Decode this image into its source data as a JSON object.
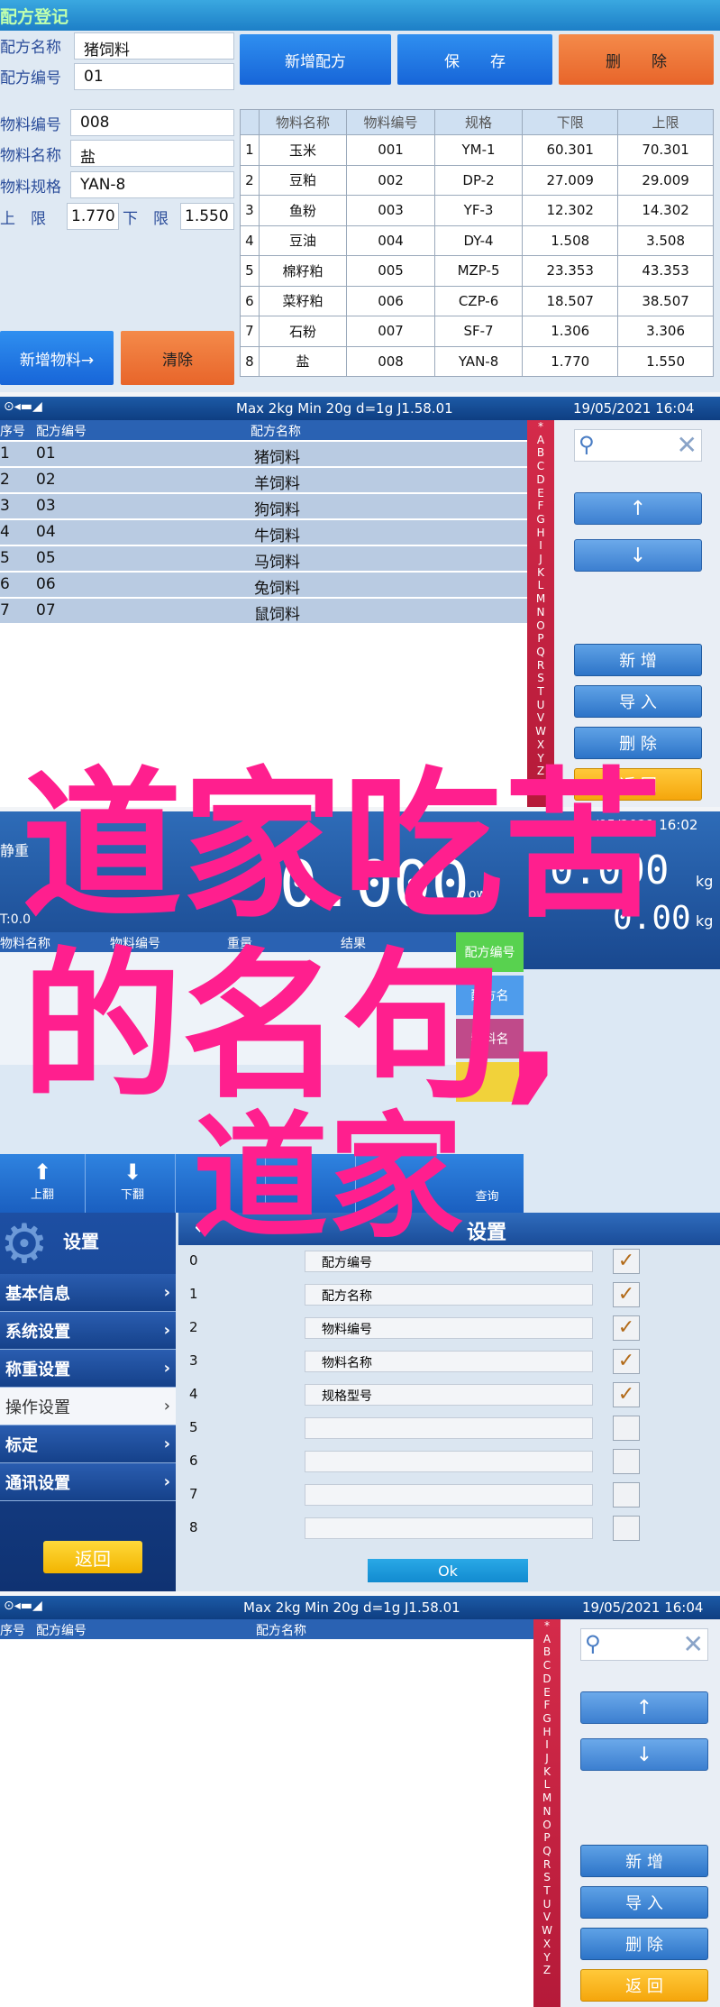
{
  "panel1": {
    "title": "配方登记",
    "recipe_name_label": "配方名称",
    "recipe_name_value": "猪饲料",
    "recipe_code_label": "配方编号",
    "recipe_code_value": "01",
    "material_code_label": "物料编号",
    "material_code_value": "008",
    "material_name_label": "物料名称",
    "material_name_value": "盐",
    "material_spec_label": "物料规格",
    "material_spec_value": "YAN-8",
    "upper_label": "上　限",
    "upper_value": "1.770",
    "lower_label": "下　限",
    "lower_value": "1.550",
    "btn_new_recipe": "新增配方",
    "btn_save": "保　　存",
    "btn_delete": "删　　除",
    "btn_new_material": "新增物料→",
    "btn_clear": "清除",
    "table_headers": [
      "",
      "物料名称",
      "物料编号",
      "规格",
      "下限",
      "上限"
    ],
    "table_rows": [
      [
        "1",
        "玉米",
        "001",
        "YM-1",
        "60.301",
        "70.301"
      ],
      [
        "2",
        "豆粕",
        "002",
        "DP-2",
        "27.009",
        "29.009"
      ],
      [
        "3",
        "鱼粉",
        "003",
        "YF-3",
        "12.302",
        "14.302"
      ],
      [
        "4",
        "豆油",
        "004",
        "DY-4",
        "1.508",
        "3.508"
      ],
      [
        "5",
        "棉籽粕",
        "005",
        "MZP-5",
        "23.353",
        "43.353"
      ],
      [
        "6",
        "菜籽粕",
        "006",
        "CZP-6",
        "18.507",
        "38.507"
      ],
      [
        "7",
        "石粉",
        "007",
        "SF-7",
        "1.306",
        "3.306"
      ],
      [
        "8",
        "盐",
        "008",
        "YAN-8",
        "1.770",
        "1.550"
      ]
    ]
  },
  "panel2": {
    "status_center": "Max 2kg  Min 20g  d=1g    J1.58.01",
    "status_right": "19/05/2021  16:04",
    "col_seq": "序号",
    "col_code": "配方编号",
    "col_name": "配方名称",
    "rows": [
      [
        "1",
        "01",
        "猪饲料"
      ],
      [
        "2",
        "02",
        "羊饲料"
      ],
      [
        "3",
        "03",
        "狗饲料"
      ],
      [
        "4",
        "04",
        "牛饲料"
      ],
      [
        "5",
        "05",
        "马饲料"
      ],
      [
        "6",
        "06",
        "兔饲料"
      ],
      [
        "7",
        "07",
        "鼠饲料"
      ]
    ],
    "alphabet": "*ABCDEFGHIJKLMNOPQRSTUVWXYZ",
    "btn_add": "新 增",
    "btn_import": "导 入",
    "btn_delete": "删 除",
    "btn_back": "返 回"
  },
  "panel3": {
    "time": "19/05/2021  16:02",
    "left_label": "静重",
    "big_value": "0.000",
    "unit": "kg",
    "small_label": "ow",
    "small_value": "0.00",
    "tare": "T:0.0",
    "col_headers": [
      "物料名称",
      "物料编号",
      "重量",
      "结果"
    ],
    "side_tabs": [
      "配方编号",
      "配方名",
      "物料名",
      "",
      ""
    ],
    "bottom_up": "上翻",
    "bottom_down": "下翻",
    "bottom_query": "查询"
  },
  "panel4": {
    "title": "设置",
    "nav_items": [
      "基本信息",
      "系统设置",
      "称重设置",
      "操作设置",
      "标定",
      "通讯设置"
    ],
    "btn_back": "返回",
    "header": "设置",
    "rows": [
      {
        "idx": "0",
        "label": "配方编号",
        "checked": true
      },
      {
        "idx": "1",
        "label": "配方名称",
        "checked": true
      },
      {
        "idx": "2",
        "label": "物料编号",
        "checked": true
      },
      {
        "idx": "3",
        "label": "物料名称",
        "checked": true
      },
      {
        "idx": "4",
        "label": "规格型号",
        "checked": true
      },
      {
        "idx": "5",
        "label": "",
        "checked": false
      },
      {
        "idx": "6",
        "label": "",
        "checked": false
      },
      {
        "idx": "7",
        "label": "",
        "checked": false
      },
      {
        "idx": "8",
        "label": "",
        "checked": false
      }
    ],
    "btn_ok": "Ok"
  },
  "panel5": {
    "status_center": "Max 2kg  Min 20g  d=1g    J1.58.01",
    "status_right": "19/05/2021  16:04",
    "col_seq": "序号",
    "col_code": "配方编号",
    "col_name": "配方名称",
    "alphabet": "*ABCDEFGHIJKLMNOPQRSTUVWXYZ",
    "btn_add": "新 增",
    "btn_import": "导 入",
    "btn_delete": "删 除",
    "btn_back": "返 回"
  },
  "overlay": {
    "line1": "道家吃苦",
    "line2": "的名句,",
    "line3": "道家"
  },
  "colors": {
    "overlay": "#ff1f8e",
    "accent_blue": "#2d74c8",
    "accent_red": "#c7223f",
    "accent_orange": "#f07a3a"
  }
}
